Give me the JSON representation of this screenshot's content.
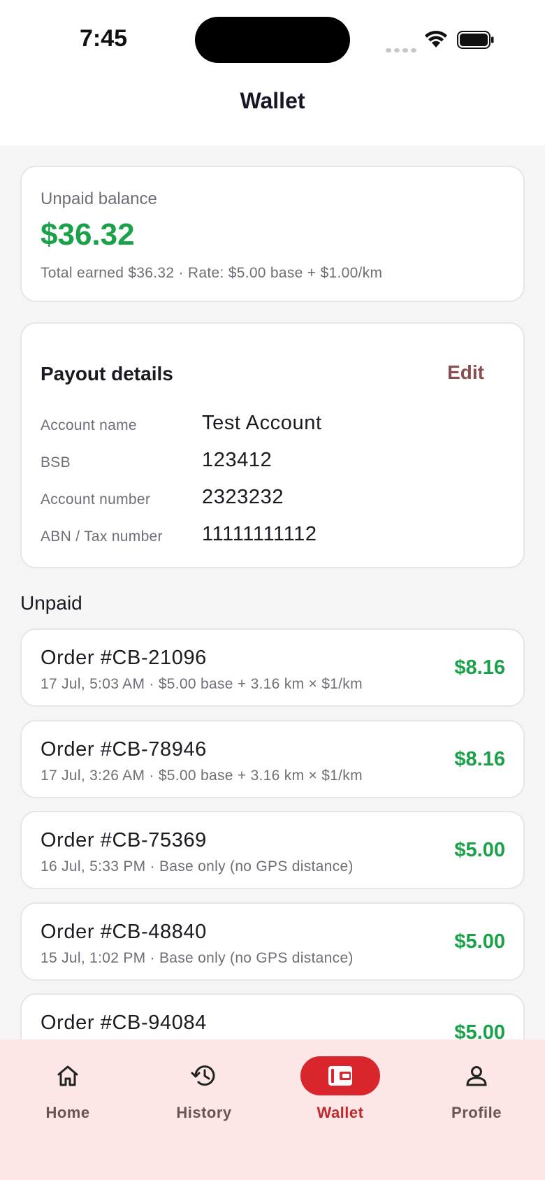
{
  "status_bar": {
    "time": "7:45"
  },
  "header": {
    "title": "Wallet"
  },
  "balance": {
    "label": "Unpaid balance",
    "amount": "$36.32",
    "meta": "Total earned $36.32 · Rate: $5.00 base + $1.00/km"
  },
  "payout": {
    "title": "Payout details",
    "edit_label": "Edit",
    "rows": [
      {
        "label": "Account name",
        "value": "Test Account"
      },
      {
        "label": "BSB",
        "value": "123412"
      },
      {
        "label": "Account number",
        "value": "2323232"
      },
      {
        "label": "ABN / Tax number",
        "value": "11111111112"
      }
    ]
  },
  "unpaid": {
    "section_title": "Unpaid",
    "orders": [
      {
        "title": "Order #CB-21096",
        "meta": "17 Jul, 5:03 AM · $5.00 base + 3.16 km × $1/km",
        "amount": "$8.16"
      },
      {
        "title": "Order #CB-78946",
        "meta": "17 Jul, 3:26 AM · $5.00 base + 3.16 km × $1/km",
        "amount": "$8.16"
      },
      {
        "title": "Order #CB-75369",
        "meta": "16 Jul, 5:33 PM · Base only (no GPS distance)",
        "amount": "$5.00"
      },
      {
        "title": "Order #CB-48840",
        "meta": "15 Jul, 1:02 PM · Base only (no GPS distance)",
        "amount": "$5.00"
      },
      {
        "title": "Order #CB-94084",
        "meta": "",
        "amount": "$5.00"
      }
    ]
  },
  "nav": {
    "items": [
      {
        "label": "Home",
        "icon": "home-icon"
      },
      {
        "label": "History",
        "icon": "history-icon"
      },
      {
        "label": "Wallet",
        "icon": "wallet-icon",
        "active": true
      },
      {
        "label": "Profile",
        "icon": "profile-icon"
      }
    ]
  },
  "colors": {
    "accent": "#d9262c",
    "positive": "#1aa14a",
    "edit": "#8a4e4e",
    "nav_background": "#fce6e6"
  }
}
